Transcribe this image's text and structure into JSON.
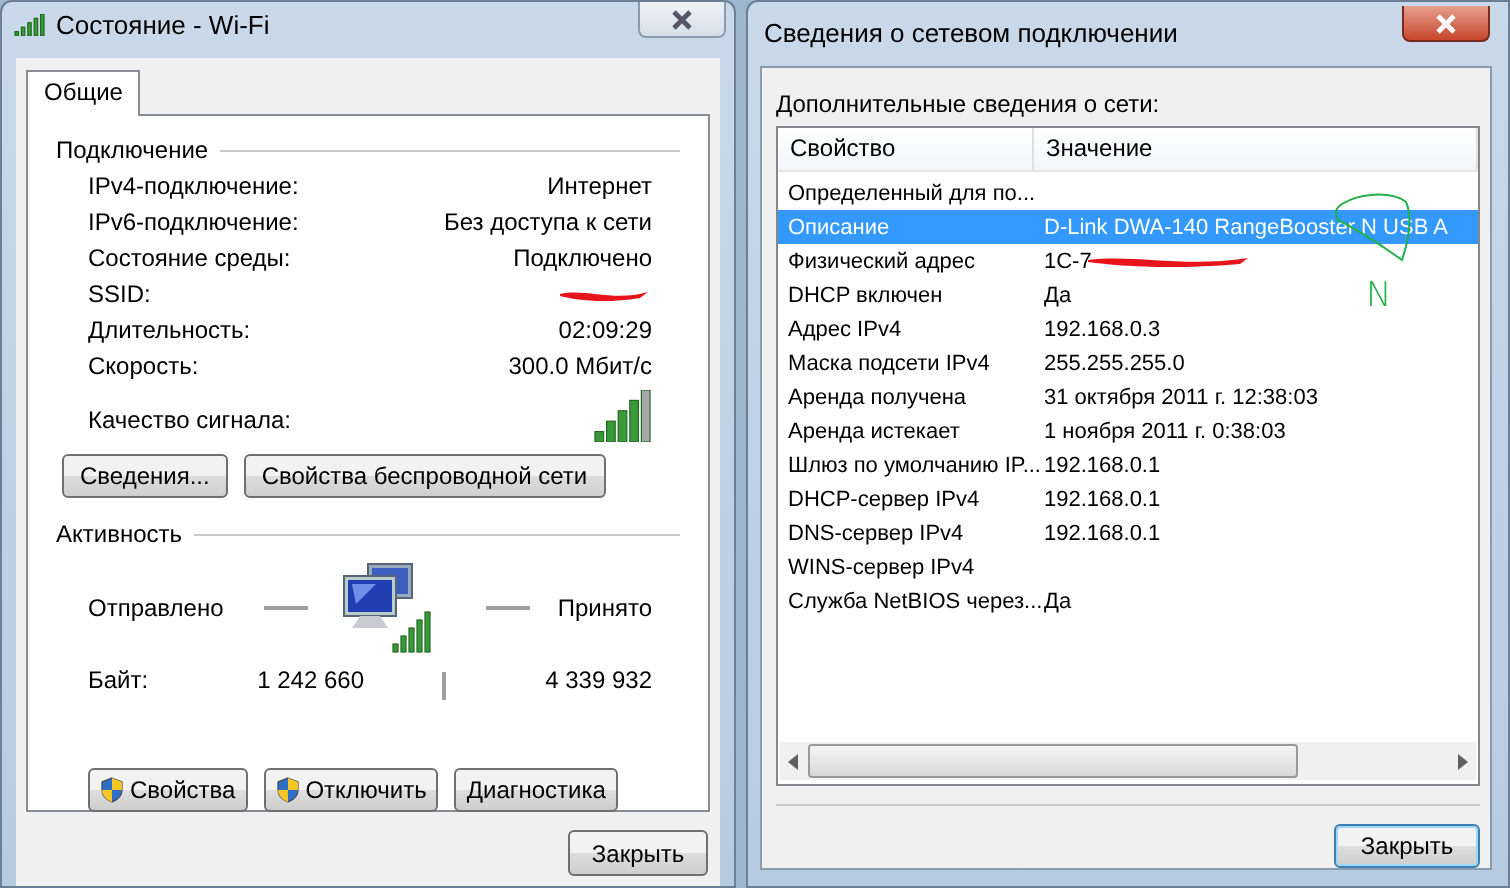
{
  "status_window": {
    "title": "Состояние - Wi-Fi",
    "tabs": [
      {
        "label": "Общие",
        "selected": true
      }
    ],
    "connection": {
      "heading": "Подключение",
      "rows": [
        {
          "label": "IPv4-подключение:",
          "value": "Интернет"
        },
        {
          "label": "IPv6-подключение:",
          "value": "Без доступа к сети"
        },
        {
          "label": "Состояние среды:",
          "value": "Подключено"
        },
        {
          "label": "SSID:",
          "redacted": true
        },
        {
          "label": "Длительность:",
          "value": "02:09:29"
        },
        {
          "label": "Скорость:",
          "value": "300.0 Мбит/с"
        }
      ],
      "signal_label": "Качество сигнала:"
    },
    "buttons": [
      "Сведения...",
      "Свойства беспроводной сети"
    ],
    "activity": {
      "heading": "Активность",
      "sent_label": "Отправлено",
      "received_label": "Принято",
      "bytes_label": "Байт:",
      "sent": "1 242 660",
      "received": "4 339 932"
    },
    "action_buttons": [
      {
        "label": "Свойства",
        "shield": true
      },
      {
        "label": "Отключить",
        "shield": true
      },
      {
        "label": "Диагностика",
        "shield": false
      }
    ],
    "close_button": "Закрыть"
  },
  "details_window": {
    "title": "Сведения о сетевом подключении",
    "caption": "Дополнительные сведения о сети:",
    "columns": [
      "Свойство",
      "Значение"
    ],
    "rows": [
      {
        "property": "Определенный для по...",
        "selected": false,
        "redacted": false
      },
      {
        "property": "Описание",
        "value": "D-Link DWA-140 RangeBooster N USB A",
        "selected": true,
        "redacted": false
      },
      {
        "property": "Физический адрес",
        "value": "1C-7",
        "selected": false,
        "redacted": true
      },
      {
        "property": "DHCP включен",
        "value": "Да",
        "selected": false,
        "redacted": false
      },
      {
        "property": "Адрес IPv4",
        "value": "192.168.0.3",
        "selected": false,
        "redacted": false
      },
      {
        "property": "Маска подсети IPv4",
        "value": "255.255.255.0",
        "selected": false,
        "redacted": false
      },
      {
        "property": "Аренда получена",
        "value": "31 октября 2011 г. 12:38:03",
        "selected": false,
        "redacted": false
      },
      {
        "property": "Аренда истекает",
        "value": "1 ноября 2011 г. 0:38:03",
        "selected": false,
        "redacted": false
      },
      {
        "property": "Шлюз по умолчанию IP...",
        "value": "192.168.0.1",
        "selected": false,
        "redacted": false
      },
      {
        "property": "DHCP-сервер IPv4",
        "value": "192.168.0.1",
        "selected": false,
        "redacted": false
      },
      {
        "property": "DNS-сервер IPv4",
        "value": "192.168.0.1",
        "selected": false,
        "redacted": false
      },
      {
        "property": "WINS-сервер IPv4",
        "selected": false,
        "redacted": false
      },
      {
        "property": "Служба NetBIOS через...",
        "value": "Да",
        "selected": false,
        "redacted": false
      }
    ],
    "annotation": {
      "text": "N"
    },
    "close_button": "Закрыть"
  }
}
